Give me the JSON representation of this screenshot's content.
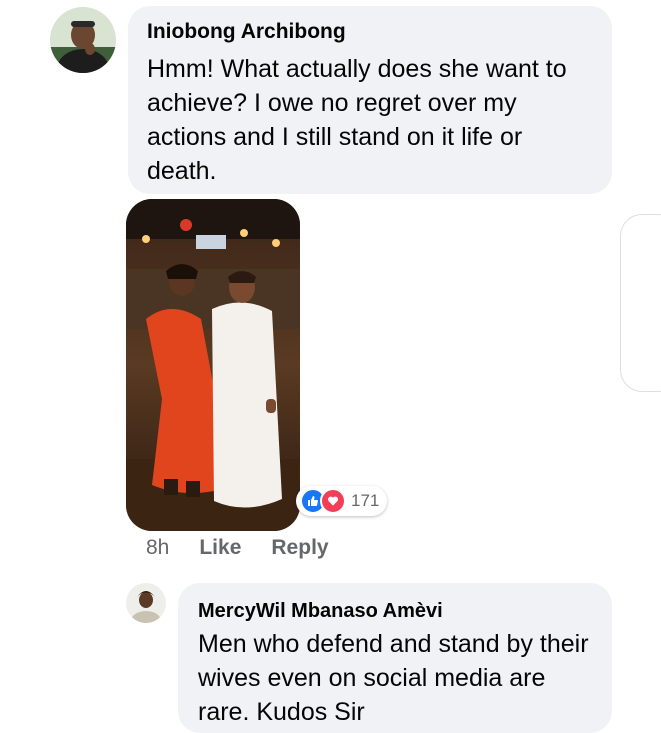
{
  "comment1": {
    "author": "Iniobong Archibong",
    "text": "Hmm! What actually does she want to achieve? I owe no regret over my actions and I still stand on it life or death.",
    "reactions": {
      "icons": [
        "like-icon",
        "love-icon"
      ],
      "count": "171"
    },
    "actions": {
      "time": "8h",
      "like_label": "Like",
      "reply_label": "Reply"
    }
  },
  "comment2": {
    "author": "MercyWil Mbanaso Amèvi",
    "text": "Men who defend and stand by their wives even on social media are rare. Kudos Sir"
  },
  "colors": {
    "bubble_bg": "#f0f2f5",
    "secondary_text": "#65676b",
    "like_blue": "#1877f2",
    "love_red": "#f33e58"
  }
}
